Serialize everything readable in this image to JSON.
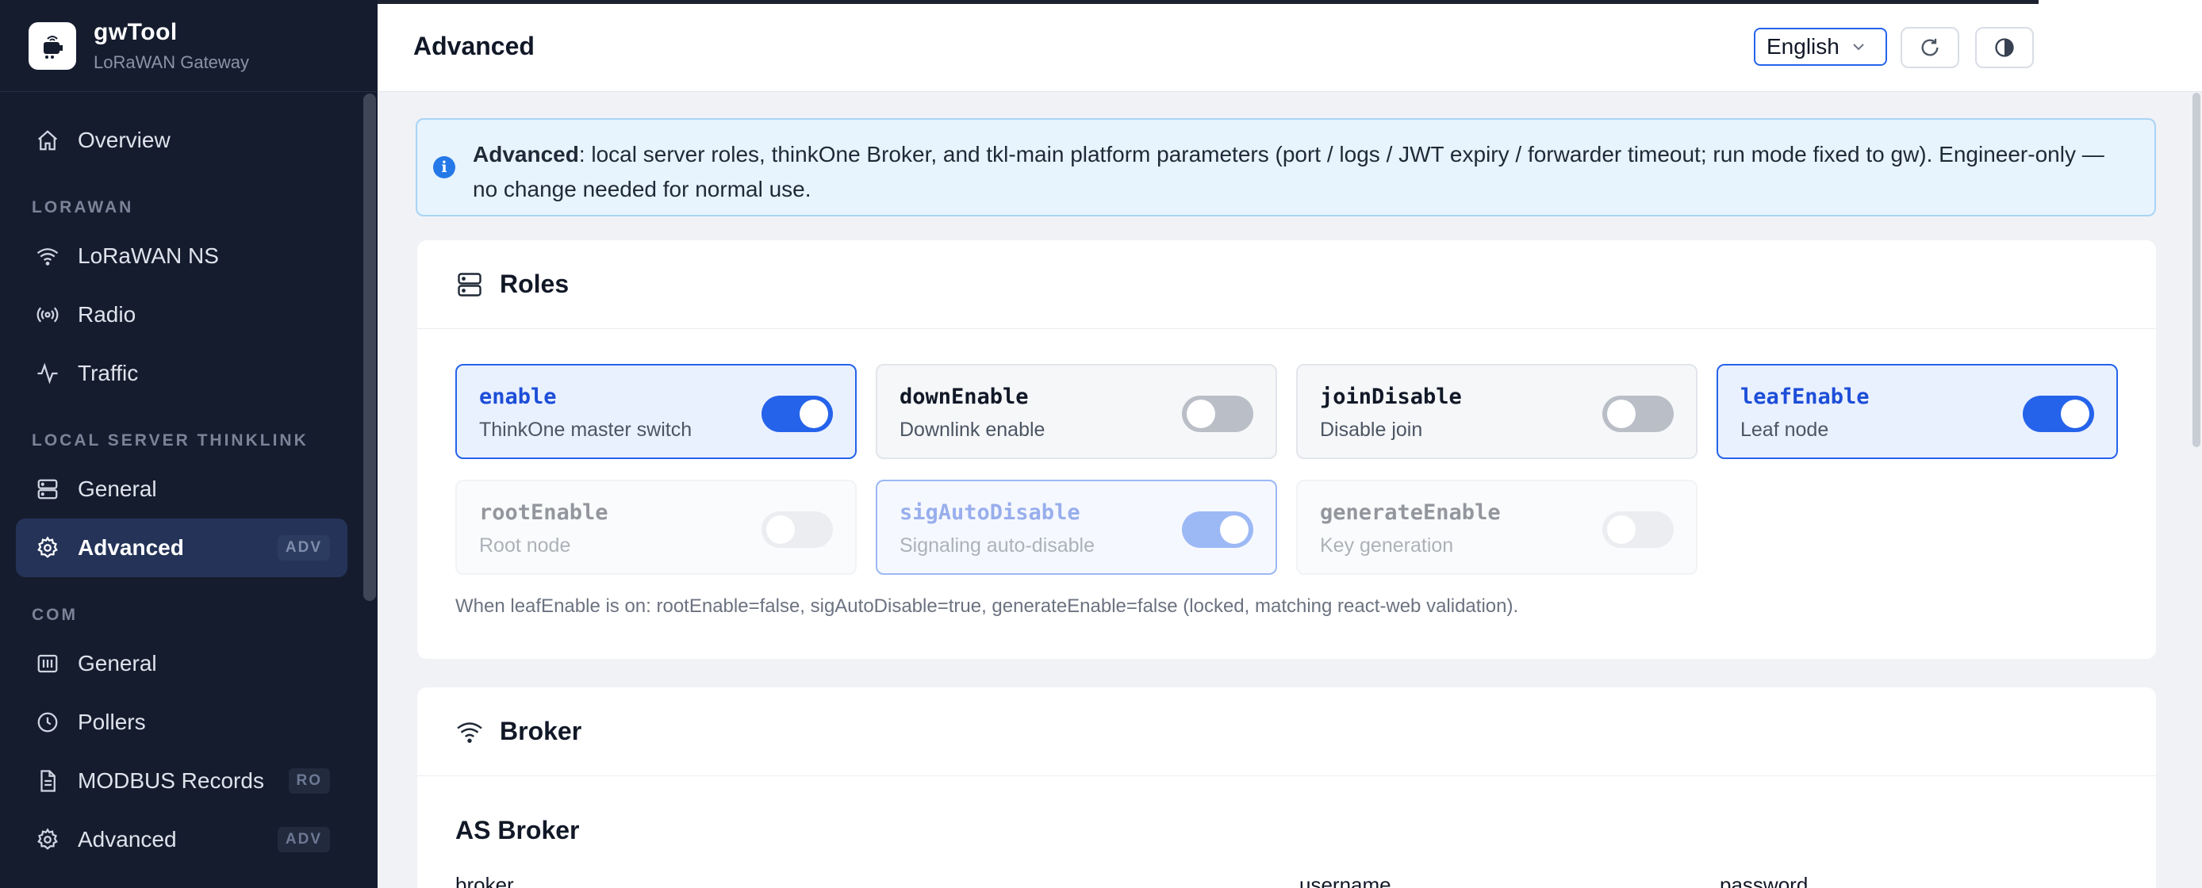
{
  "app": {
    "name": "gwTool",
    "subtitle": "LoRaWAN Gateway"
  },
  "sidebar": {
    "items": [
      {
        "id": "overview",
        "label": "Overview",
        "icon": "home-icon"
      },
      {
        "section": "LORAWAN"
      },
      {
        "id": "lorawan-ns",
        "label": "LoRaWAN NS",
        "icon": "wifi-icon"
      },
      {
        "id": "radio",
        "label": "Radio",
        "icon": "radio-icon"
      },
      {
        "id": "traffic",
        "label": "Traffic",
        "icon": "activity-icon"
      },
      {
        "section": "LOCAL SERVER THINKLINK"
      },
      {
        "id": "tk-general",
        "label": "General",
        "icon": "server-icon"
      },
      {
        "id": "tk-advanced",
        "label": "Advanced",
        "icon": "gear-icon",
        "badge": "ADV",
        "active": true
      },
      {
        "section": "COM"
      },
      {
        "id": "com-general",
        "label": "General",
        "icon": "grid-icon"
      },
      {
        "id": "pollers",
        "label": "Pollers",
        "icon": "clock-icon"
      },
      {
        "id": "modbus",
        "label": "MODBUS Records",
        "icon": "document-icon",
        "badge": "RO"
      },
      {
        "id": "com-advanced",
        "label": "Advanced",
        "icon": "gear-icon",
        "badge": "ADV"
      }
    ]
  },
  "header": {
    "title": "Advanced",
    "language": "English",
    "refresh_icon": "refresh-icon",
    "theme_icon": "contrast-icon"
  },
  "info": {
    "bold": "Advanced",
    "text": ": local server roles, thinkOne Broker, and tkl-main platform parameters (port / logs / JWT expiry / forwarder timeout; run mode fixed to gw). Engineer-only — no change needed for normal use."
  },
  "roles": {
    "title": "Roles",
    "items": [
      {
        "name": "enable",
        "desc": "ThinkOne master switch",
        "on": true,
        "locked": false
      },
      {
        "name": "downEnable",
        "desc": "Downlink enable",
        "on": false,
        "locked": false
      },
      {
        "name": "joinDisable",
        "desc": "Disable join",
        "on": false,
        "locked": false
      },
      {
        "name": "leafEnable",
        "desc": "Leaf node",
        "on": true,
        "locked": false
      },
      {
        "name": "rootEnable",
        "desc": "Root node",
        "on": false,
        "locked": true
      },
      {
        "name": "sigAutoDisable",
        "desc": "Signaling auto-disable",
        "on": true,
        "locked": true
      },
      {
        "name": "generateEnable",
        "desc": "Key generation",
        "on": false,
        "locked": true
      }
    ],
    "note": "When leafEnable is on: rootEnable=false, sigAutoDisable=true, generateEnable=false (locked, matching react-web validation)."
  },
  "broker": {
    "title": "Broker",
    "section": "AS Broker",
    "fields": [
      "broker",
      "username",
      "password"
    ]
  },
  "colors": {
    "accent": "#2563eb",
    "sidebar_bg": "#151c2e",
    "info_bg": "#e7f3fd"
  }
}
